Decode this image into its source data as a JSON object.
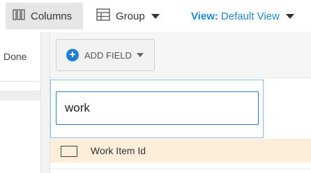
{
  "toolbar": {
    "columns_label": "Columns",
    "group_label": "Group",
    "view_prefix": "View:",
    "view_value": "Default View"
  },
  "left_panel": {
    "done_label": "Done"
  },
  "add_field": {
    "label": "ADD FIELD",
    "icon": "plus-circle-icon"
  },
  "search": {
    "value": "work"
  },
  "results": [
    {
      "label": "Work Item Id",
      "checked": false
    }
  ],
  "colors": {
    "accent": "#1e88d7",
    "highlight_row": "#fdeed9",
    "active_button_bg": "#e6e6e6",
    "input_border": "#2e78c8"
  }
}
